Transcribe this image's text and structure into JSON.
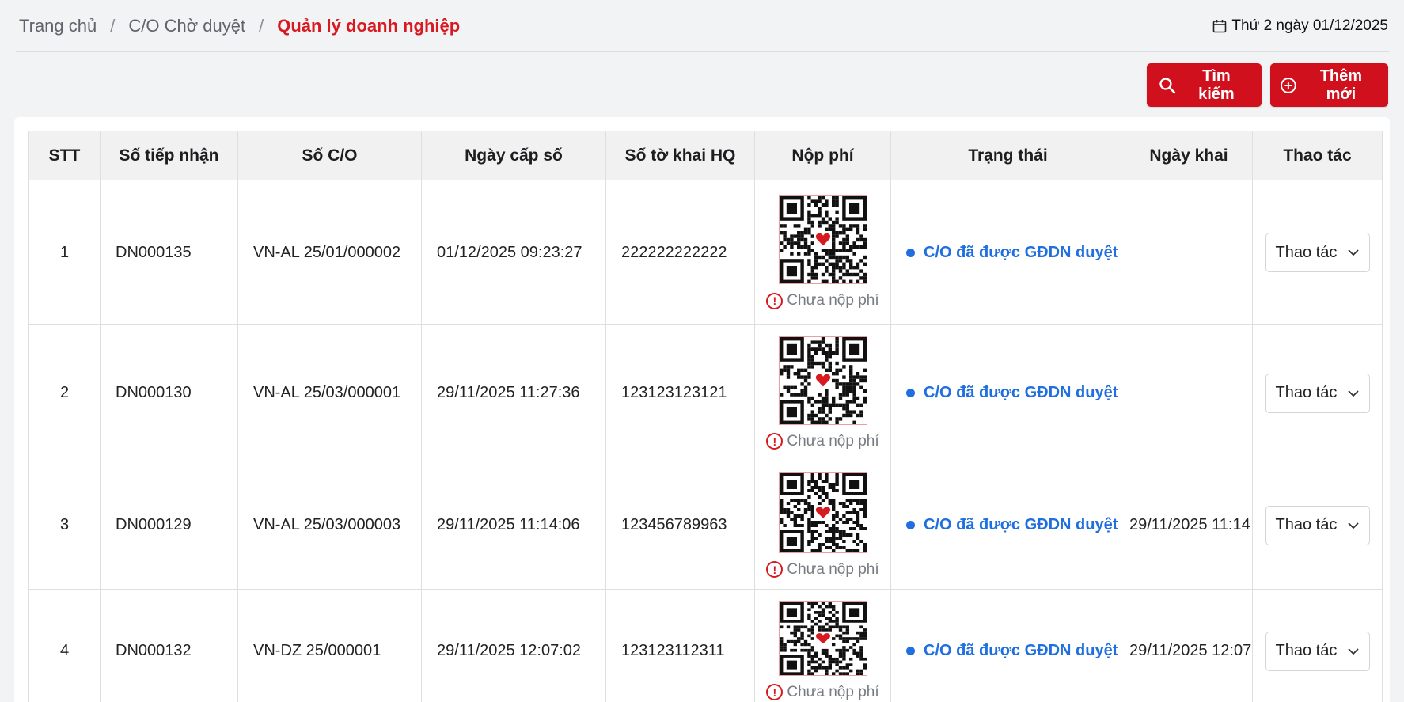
{
  "breadcrumb": {
    "home": "Trang chủ",
    "pending": "C/O Chờ duyệt",
    "current": "Quản lý doanh nghiệp",
    "separator": "/"
  },
  "date_text": "Thứ 2 ngày 01/12/2025",
  "buttons": {
    "search": "Tìm kiếm",
    "add": "Thêm mới"
  },
  "colors": {
    "accent": "#d0101c",
    "status_blue": "#1f6fe0",
    "error_red": "#d71920"
  },
  "table": {
    "headers": [
      "STT",
      "Số tiếp nhận",
      "Số C/O",
      "Ngày cấp số",
      "Số tờ khai HQ",
      "Nộp phí",
      "Trạng thái",
      "Ngày khai",
      "Thao tác"
    ],
    "rows": [
      {
        "stt": "1",
        "so_tiep_nhan": "DN000135",
        "so_co": "VN-AL 25/01/000002",
        "ngay_cap_so": "01/12/2025 09:23:27",
        "so_to_khai": "222222222222",
        "fee_status": "Chưa nộp phí",
        "trang_thai": "C/O đã được GĐDN duyệt",
        "ngay_khai": "",
        "action": "Thao tác"
      },
      {
        "stt": "2",
        "so_tiep_nhan": "DN000130",
        "so_co": "VN-AL 25/03/000001",
        "ngay_cap_so": "29/11/2025 11:27:36",
        "so_to_khai": "123123123121",
        "fee_status": "Chưa nộp phí",
        "trang_thai": "C/O đã được GĐDN duyệt",
        "ngay_khai": "",
        "action": "Thao tác"
      },
      {
        "stt": "3",
        "so_tiep_nhan": "DN000129",
        "so_co": "VN-AL 25/03/000003",
        "ngay_cap_so": "29/11/2025 11:14:06",
        "so_to_khai": "123456789963",
        "fee_status": "Chưa nộp phí",
        "trang_thai": "C/O đã được GĐDN duyệt",
        "ngay_khai": "29/11/2025 11:14",
        "action": "Thao tác"
      },
      {
        "stt": "4",
        "so_tiep_nhan": "DN000132",
        "so_co": "VN-DZ 25/000001",
        "ngay_cap_so": "29/11/2025 12:07:02",
        "so_to_khai": "123123112311",
        "fee_status": "Chưa nộp phí",
        "trang_thai": "C/O đã được GĐDN duyệt",
        "ngay_khai": "29/11/2025 12:07",
        "action": "Thao tác"
      }
    ]
  }
}
